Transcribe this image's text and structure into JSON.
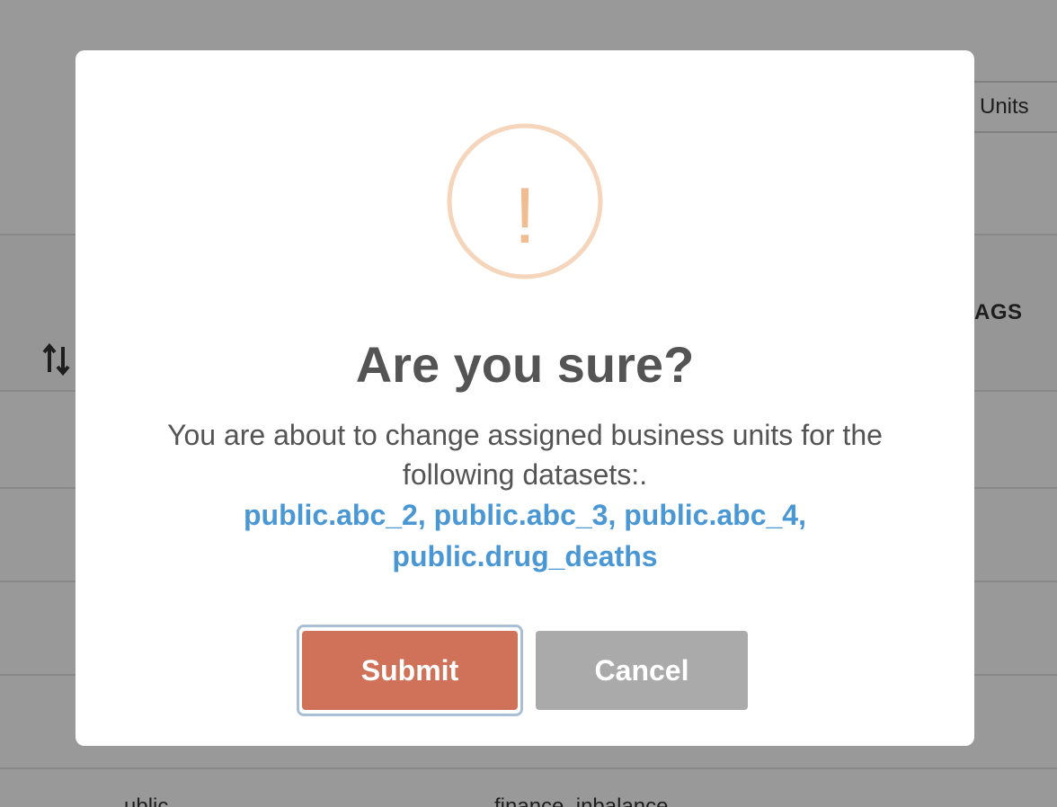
{
  "background": {
    "units_button_label": "Units",
    "column_header": "AGS",
    "bottom_text_left": "ublic",
    "bottom_text_right": "finance_inbalance"
  },
  "modal": {
    "icon": "exclamation-warning-icon",
    "icon_glyph": "!",
    "icon_color": "#f5c9a6",
    "title": "Are you sure?",
    "message": "You are about to change assigned business units for the following datasets:.",
    "datasets": "public.abc_2, public.abc_3, public.abc_4, public.drug_deaths",
    "submit_label": "Submit",
    "cancel_label": "Cancel"
  },
  "colors": {
    "submit": "#d07259",
    "cancel": "#aaaaaa",
    "dataset_link": "#4a97d6",
    "overlay": "rgba(0,0,0,0.4)"
  }
}
